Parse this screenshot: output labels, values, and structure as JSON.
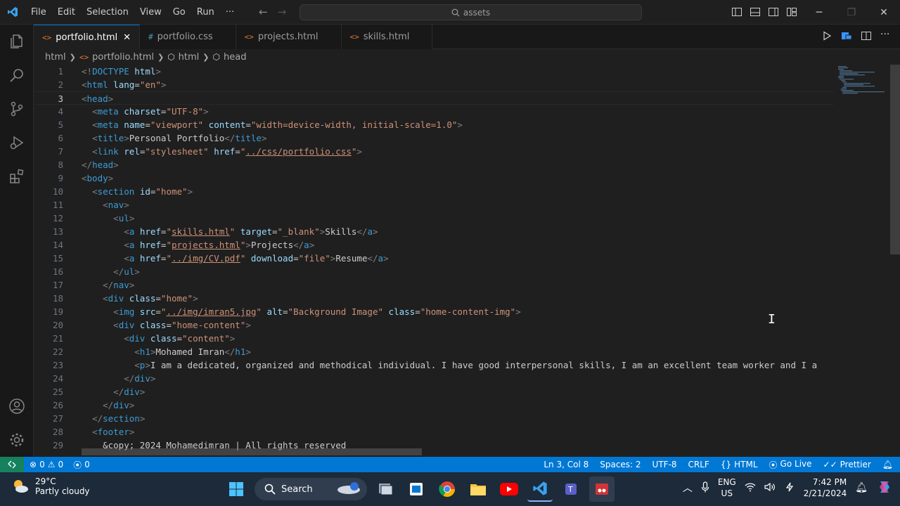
{
  "menu": [
    "File",
    "Edit",
    "Selection",
    "View",
    "Go",
    "Run",
    "···"
  ],
  "command_center": "assets",
  "tabs": [
    {
      "label": "portfolio.html",
      "icon": "<>",
      "active": true
    },
    {
      "label": "portfolio.css",
      "icon": "#",
      "active": false
    },
    {
      "label": "projects.html",
      "icon": "<>",
      "active": false
    },
    {
      "label": "skills.html",
      "icon": "<>",
      "active": false
    }
  ],
  "breadcrumb": [
    "html",
    "portfolio.html",
    "html",
    "head"
  ],
  "code_lines": [
    {
      "n": "1",
      "html": "<span class=\"tg\">&lt;!</span><span class=\"t\">DOCTYPE</span> <span class=\"a\">html</span><span class=\"tg\">&gt;</span>"
    },
    {
      "n": "2",
      "html": "<span class=\"tg\">&lt;</span><span class=\"t\">html</span> <span class=\"a\">lang</span>=<span class=\"s\">\"en\"</span><span class=\"tg\">&gt;</span>"
    },
    {
      "n": "3",
      "html": "<span class=\"tg\">&lt;</span><span class=\"t\">head</span><span class=\"tg\">&gt;</span>",
      "current": true
    },
    {
      "n": "4",
      "html": "  <span class=\"tg\">&lt;</span><span class=\"t\">meta</span> <span class=\"a\">charset</span>=<span class=\"s\">\"UTF-8\"</span><span class=\"tg\">&gt;</span>"
    },
    {
      "n": "5",
      "html": "  <span class=\"tg\">&lt;</span><span class=\"t\">meta</span> <span class=\"a\">name</span>=<span class=\"s\">\"viewport\"</span> <span class=\"a\">content</span>=<span class=\"s\">\"width=device-width, initial-scale=1.0\"</span><span class=\"tg\">&gt;</span>"
    },
    {
      "n": "6",
      "html": "  <span class=\"tg\">&lt;</span><span class=\"t\">title</span><span class=\"tg\">&gt;</span>Personal Portfolio<span class=\"tg\">&lt;/</span><span class=\"t\">title</span><span class=\"tg\">&gt;</span>"
    },
    {
      "n": "7",
      "html": "  <span class=\"tg\">&lt;</span><span class=\"t\">link</span> <span class=\"a\">rel</span>=<span class=\"s\">\"stylesheet\"</span> <span class=\"a\">href</span>=<span class=\"s\">\"<span class=\"u\">../css/portfolio.css</span>\"</span><span class=\"tg\">&gt;</span>"
    },
    {
      "n": "8",
      "html": "<span class=\"tg\">&lt;/</span><span class=\"t\">head</span><span class=\"tg\">&gt;</span>"
    },
    {
      "n": "9",
      "html": "<span class=\"tg\">&lt;</span><span class=\"t\">body</span><span class=\"tg\">&gt;</span>"
    },
    {
      "n": "10",
      "html": "  <span class=\"tg\">&lt;</span><span class=\"t\">section</span> <span class=\"a\">id</span>=<span class=\"s\">\"home\"</span><span class=\"tg\">&gt;</span>"
    },
    {
      "n": "11",
      "html": "    <span class=\"tg\">&lt;</span><span class=\"t\">nav</span><span class=\"tg\">&gt;</span>"
    },
    {
      "n": "12",
      "html": "      <span class=\"tg\">&lt;</span><span class=\"t\">ul</span><span class=\"tg\">&gt;</span>"
    },
    {
      "n": "13",
      "html": "        <span class=\"tg\">&lt;</span><span class=\"t\">a</span> <span class=\"a\">href</span>=<span class=\"s\">\"<span class=\"u\">skills.html</span>\"</span> <span class=\"a\">target</span>=<span class=\"s\">\"_blank\"</span><span class=\"tg\">&gt;</span>Skills<span class=\"tg\">&lt;/</span><span class=\"t\">a</span><span class=\"tg\">&gt;</span>"
    },
    {
      "n": "14",
      "html": "        <span class=\"tg\">&lt;</span><span class=\"t\">a</span> <span class=\"a\">href</span>=<span class=\"s\">\"<span class=\"u\">projects.html</span>\"</span><span class=\"tg\">&gt;</span>Projects<span class=\"tg\">&lt;/</span><span class=\"t\">a</span><span class=\"tg\">&gt;</span>"
    },
    {
      "n": "15",
      "html": "        <span class=\"tg\">&lt;</span><span class=\"t\">a</span> <span class=\"a\">href</span>=<span class=\"s\">\"<span class=\"u\">../img/CV.pdf</span>\"</span> <span class=\"a\">download</span>=<span class=\"s\">\"file\"</span><span class=\"tg\">&gt;</span>Resume<span class=\"tg\">&lt;/</span><span class=\"t\">a</span><span class=\"tg\">&gt;</span>"
    },
    {
      "n": "16",
      "html": "      <span class=\"tg\">&lt;/</span><span class=\"t\">ul</span><span class=\"tg\">&gt;</span>"
    },
    {
      "n": "17",
      "html": "    <span class=\"tg\">&lt;/</span><span class=\"t\">nav</span><span class=\"tg\">&gt;</span>"
    },
    {
      "n": "18",
      "html": "    <span class=\"tg\">&lt;</span><span class=\"t\">div</span> <span class=\"a\">class</span>=<span class=\"s\">\"home\"</span><span class=\"tg\">&gt;</span>"
    },
    {
      "n": "19",
      "html": "      <span class=\"tg\">&lt;</span><span class=\"t\">img</span> <span class=\"a\">src</span>=<span class=\"s\">\"<span class=\"u\">../img/imran5.jpg</span>\"</span> <span class=\"a\">alt</span>=<span class=\"s\">\"Background Image\"</span> <span class=\"a\">class</span>=<span class=\"s\">\"home-content-img\"</span><span class=\"tg\">&gt;</span>"
    },
    {
      "n": "20",
      "html": "      <span class=\"tg\">&lt;</span><span class=\"t\">div</span> <span class=\"a\">class</span>=<span class=\"s\">\"home-content\"</span><span class=\"tg\">&gt;</span>"
    },
    {
      "n": "21",
      "html": "        <span class=\"tg\">&lt;</span><span class=\"t\">div</span> <span class=\"a\">class</span>=<span class=\"s\">\"content\"</span><span class=\"tg\">&gt;</span>"
    },
    {
      "n": "22",
      "html": "          <span class=\"tg\">&lt;</span><span class=\"t\">h1</span><span class=\"tg\">&gt;</span>Mohamed Imran<span class=\"tg\">&lt;/</span><span class=\"t\">h1</span><span class=\"tg\">&gt;</span>"
    },
    {
      "n": "23",
      "html": "          <span class=\"tg\">&lt;</span><span class=\"t\">p</span><span class=\"tg\">&gt;</span>I am a dedicated, organized and methodical individual. I have good interpersonal skills, I am an excellent team worker and I a"
    },
    {
      "n": "24",
      "html": "        <span class=\"tg\">&lt;/</span><span class=\"t\">div</span><span class=\"tg\">&gt;</span>"
    },
    {
      "n": "25",
      "html": "      <span class=\"tg\">&lt;/</span><span class=\"t\">div</span><span class=\"tg\">&gt;</span>"
    },
    {
      "n": "26",
      "html": "    <span class=\"tg\">&lt;/</span><span class=\"t\">div</span><span class=\"tg\">&gt;</span>"
    },
    {
      "n": "27",
      "html": "  <span class=\"tg\">&lt;/</span><span class=\"t\">section</span><span class=\"tg\">&gt;</span>"
    },
    {
      "n": "28",
      "html": "  <span class=\"tg\">&lt;</span><span class=\"t\">footer</span><span class=\"tg\">&gt;</span>"
    },
    {
      "n": "29",
      "html": "    &amp;copy; 2024 Mohamedimran | All rights reserved"
    }
  ],
  "status": {
    "errors": "0",
    "warnings": "0",
    "ports": "0",
    "position": "Ln 3, Col 8",
    "spaces": "Spaces: 2",
    "encoding": "UTF-8",
    "eol": "CRLF",
    "language": "HTML",
    "golive": "Go Live",
    "prettier": "Prettier"
  },
  "taskbar": {
    "temp": "29°C",
    "weather": "Partly cloudy",
    "search": "Search",
    "lang1": "ENG",
    "lang2": "US",
    "time": "7:42 PM",
    "date": "2/21/2024"
  },
  "colors": {
    "accent": "#0078d4",
    "remote": "#16825d"
  }
}
